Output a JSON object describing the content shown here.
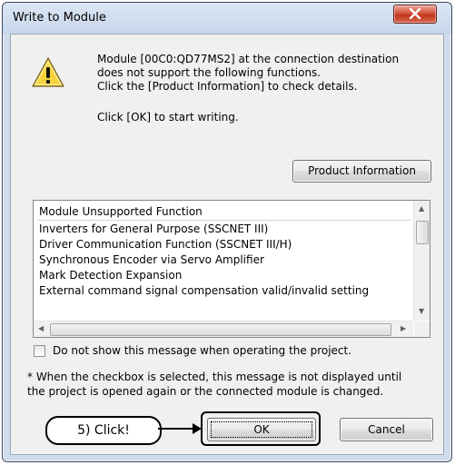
{
  "window": {
    "title": "Write to Module",
    "close_glyph": "x"
  },
  "message": {
    "line1": "Module [00C0:QD77MS2] at the connection destination",
    "line2": "does not support the following functions.",
    "line3": "Click the [Product Information] to check details.",
    "line4": "Click [OK] to start writing."
  },
  "buttons": {
    "product_info": "Product Information",
    "ok": "OK",
    "cancel": "Cancel"
  },
  "list": {
    "header": "Module Unsupported Function",
    "items": [
      "Inverters for General Purpose (SSCNET III)",
      "Driver Communication Function (SSCNET III/H)",
      "Synchronous Encoder via Servo Amplifier",
      "Mark Detection Expansion",
      "External command signal compensation valid/invalid setting"
    ]
  },
  "checkbox": {
    "label": "Do not show this message when operating the project.",
    "checked": false
  },
  "note": {
    "line1": "* When the checkbox is selected, this message is not displayed until",
    "line2": "the project is opened again or the connected module is changed."
  },
  "annotation": {
    "callout": "5) Click!"
  },
  "icons": {
    "warning": "warning-icon",
    "close": "close-icon"
  },
  "colors": {
    "warning_fill": "#f7d23a",
    "close_button": "#c7402a",
    "titlebar": "#cfdcec"
  }
}
